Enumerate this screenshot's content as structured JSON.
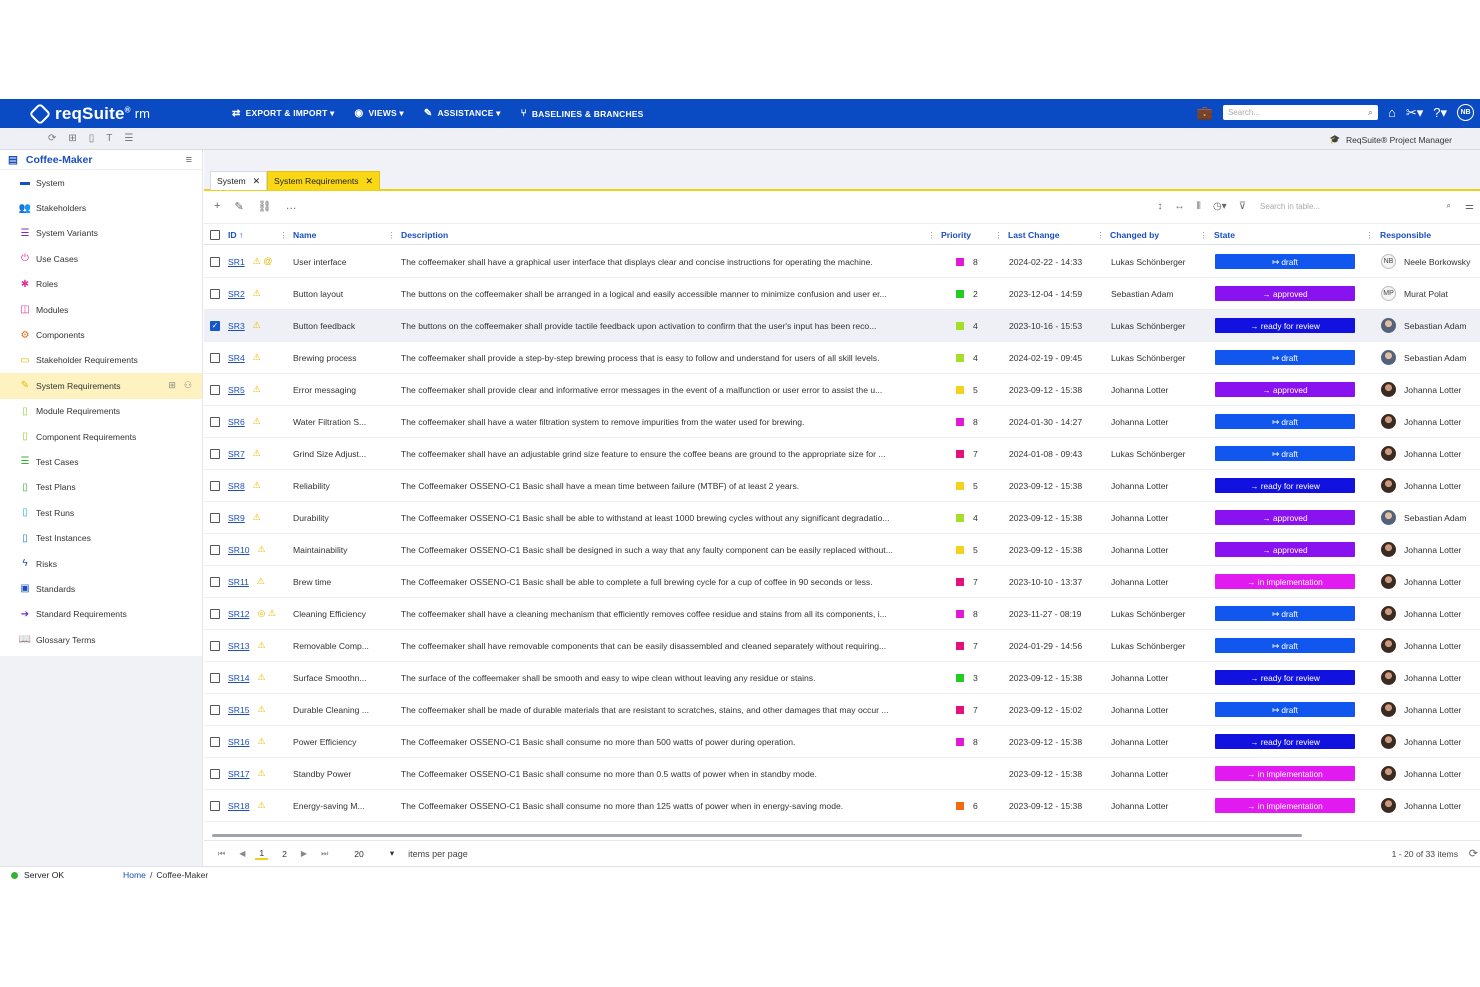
{
  "topbar": {
    "brand": "reqSuite",
    "brand_sup": "®",
    "brand_suffix": "rm",
    "nav": [
      {
        "icon": "⇄",
        "label": "EXPORT & IMPORT ▾"
      },
      {
        "icon": "◉",
        "label": "VIEWS ▾"
      },
      {
        "icon": "✎",
        "label": "ASSISTANCE ▾"
      },
      {
        "icon": "⑂",
        "label": "BASELINES & BRANCHES"
      }
    ],
    "search_placeholder": "Search...",
    "avatar": "NB"
  },
  "subbar": {
    "project_manager": "ReqSuite® Project Manager"
  },
  "sidebar": {
    "title": "Coffee-Maker",
    "items": [
      {
        "label": "System",
        "icon": "▬",
        "color": "#1a4fbf"
      },
      {
        "label": "Stakeholders",
        "icon": "👥",
        "color": "#1a4fbf"
      },
      {
        "label": "System Variants",
        "icon": "☰",
        "color": "#7a2fbf"
      },
      {
        "label": "Use Cases",
        "icon": "⏻",
        "color": "#e0349a"
      },
      {
        "label": "Roles",
        "icon": "✱",
        "color": "#e0349a"
      },
      {
        "label": "Modules",
        "icon": "◫",
        "color": "#e0349a"
      },
      {
        "label": "Components",
        "icon": "⚙",
        "color": "#e06a1a"
      },
      {
        "label": "Stakeholder Requirements",
        "icon": "▭",
        "color": "#e6b800"
      },
      {
        "label": "System Requirements",
        "icon": "✎",
        "color": "#e6b800"
      },
      {
        "label": "Module Requirements",
        "icon": "▯",
        "color": "#9acd32"
      },
      {
        "label": "Component Requirements",
        "icon": "▯",
        "color": "#9acd32"
      },
      {
        "label": "Test Cases",
        "icon": "☰",
        "color": "#34b233"
      },
      {
        "label": "Test Plans",
        "icon": "▯",
        "color": "#34b233"
      },
      {
        "label": "Test Runs",
        "icon": "▯",
        "color": "#1ab0c8"
      },
      {
        "label": "Test Instances",
        "icon": "▯",
        "color": "#1a7fd0"
      },
      {
        "label": "Risks",
        "icon": "ϟ",
        "color": "#1a4fbf"
      },
      {
        "label": "Standards",
        "icon": "▣",
        "color": "#1a4fbf"
      },
      {
        "label": "Standard Requirements",
        "icon": "➔",
        "color": "#7a2fbf"
      },
      {
        "label": "Glossary Terms",
        "icon": "📖",
        "color": "#7a2fbf"
      }
    ]
  },
  "tabs": [
    {
      "label": "System",
      "close": "✕"
    },
    {
      "label": "System Requirements",
      "close": "✕"
    }
  ],
  "table": {
    "search_placeholder": "Search in table...",
    "columns": {
      "id": "ID ↑",
      "name": "Name",
      "description": "Description",
      "priority": "Priority",
      "last_change": "Last Change",
      "changed_by": "Changed by",
      "state": "State",
      "responsible": "Responsible"
    },
    "rows": [
      {
        "id": "SR1",
        "flags": "⚠ @",
        "name": "User interface",
        "desc": "The coffeemaker shall have a graphical user interface that displays clear and concise instructions for operating the machine.",
        "pcolor": "#e21ad6",
        "priority": "8",
        "date": "2024-02-22 - 14:33",
        "by": "Lukas Schönberger",
        "state": "↦ draft",
        "scolor": "#1256f0",
        "resp": "Neele Borkowsky",
        "rinit": "NB"
      },
      {
        "id": "SR2",
        "flags": "⚠",
        "name": "Button layout",
        "desc": "The buttons on the coffeemaker shall be arranged in a logical and easily accessible manner to minimize confusion and user er...",
        "pcolor": "#22cc22",
        "priority": "2",
        "date": "2023-12-04 - 14:59",
        "by": "Sebastian Adam",
        "state": "→ approved",
        "scolor": "#8a12f0",
        "resp": "Murat Polat",
        "rinit": "MP"
      },
      {
        "id": "SR3",
        "flags": "⚠",
        "name": "Button feedback",
        "desc": "The buttons on the coffeemaker shall provide tactile feedback upon activation to confirm that the user's input has been reco...",
        "pcolor": "#a4e02a",
        "priority": "4",
        "date": "2023-10-16 - 15:53",
        "by": "Lukas Schönberger",
        "state": "→ ready for review",
        "scolor": "#1212e0",
        "resp": "Sebastian Adam",
        "rinit": ""
      },
      {
        "id": "SR4",
        "flags": "⚠",
        "name": "Brewing process",
        "desc": "The coffeemaker shall provide a step-by-step brewing process that is easy to follow and understand for users of all skill levels.",
        "pcolor": "#a4e02a",
        "priority": "4",
        "date": "2024-02-19 - 09:45",
        "by": "Lukas Schönberger",
        "state": "↦ draft",
        "scolor": "#1256f0",
        "resp": "Sebastian Adam",
        "rinit": ""
      },
      {
        "id": "SR5",
        "flags": "⚠",
        "name": "Error messaging",
        "desc": "The coffeemaker shall provide clear and informative error messages in the event of a malfunction or user error to assist the u...",
        "pcolor": "#f2d21a",
        "priority": "5",
        "date": "2023-09-12 - 15:38",
        "by": "Johanna Lotter",
        "state": "→ approved",
        "scolor": "#8a12f0",
        "resp": "Johanna Lotter",
        "rinit": ""
      },
      {
        "id": "SR6",
        "flags": "⚠",
        "name": "Water Filtration S...",
        "desc": "The coffeemaker shall have a water filtration system to remove impurities from the water used for brewing.",
        "pcolor": "#e21ad6",
        "priority": "8",
        "date": "2024-01-30 - 14:27",
        "by": "Johanna Lotter",
        "state": "↦ draft",
        "scolor": "#1256f0",
        "resp": "Johanna Lotter",
        "rinit": ""
      },
      {
        "id": "SR7",
        "flags": "⚠",
        "name": "Grind Size Adjust...",
        "desc": "The coffeemaker shall have an adjustable grind size feature to ensure the coffee beans are ground to the appropriate size for ...",
        "pcolor": "#e2127a",
        "priority": "7",
        "date": "2024-01-08 - 09:43",
        "by": "Lukas Schönberger",
        "state": "↦ draft",
        "scolor": "#1256f0",
        "resp": "Johanna Lotter",
        "rinit": ""
      },
      {
        "id": "SR8",
        "flags": "⚠",
        "name": "Reliability",
        "desc": "The Coffeemaker OSSENO-C1 Basic shall have a mean time between failure (MTBF) of at least 2 years.",
        "pcolor": "#f2d21a",
        "priority": "5",
        "date": "2023-09-12 - 15:38",
        "by": "Johanna Lotter",
        "state": "→ ready for review",
        "scolor": "#1212e0",
        "resp": "Johanna Lotter",
        "rinit": ""
      },
      {
        "id": "SR9",
        "flags": "⚠",
        "name": "Durability",
        "desc": "The Coffeemaker OSSENO-C1 Basic shall be able to withstand at least 1000 brewing cycles without any significant degradatio...",
        "pcolor": "#a4e02a",
        "priority": "4",
        "date": "2023-09-12 - 15:38",
        "by": "Johanna Lotter",
        "state": "→ approved",
        "scolor": "#8a12f0",
        "resp": "Sebastian Adam",
        "rinit": ""
      },
      {
        "id": "SR10",
        "flags": "⚠",
        "name": "Maintainability",
        "desc": "The Coffeemaker OSSENO-C1 Basic shall be designed in such a way that any faulty component can be easily replaced without...",
        "pcolor": "#f2d21a",
        "priority": "5",
        "date": "2023-09-12 - 15:38",
        "by": "Johanna Lotter",
        "state": "→ approved",
        "scolor": "#8a12f0",
        "resp": "Johanna Lotter",
        "rinit": ""
      },
      {
        "id": "SR11",
        "flags": "⚠",
        "name": "Brew time",
        "desc": "The Coffeemaker OSSENO-C1 Basic shall be able to complete a full brewing cycle for a cup of coffee in 90 seconds or less.",
        "pcolor": "#e2127a",
        "priority": "7",
        "date": "2023-10-10 - 13:37",
        "by": "Johanna Lotter",
        "state": "→ in implementation",
        "scolor": "#e01af0",
        "resp": "Johanna Lotter",
        "rinit": ""
      },
      {
        "id": "SR12",
        "flags": "◎ ⚠",
        "name": "Cleaning Efficiency",
        "desc": "The coffeemaker shall have a cleaning mechanism that efficiently removes coffee residue and stains from all its components, i...",
        "pcolor": "#e21ad6",
        "priority": "8",
        "date": "2023-11-27 - 08:19",
        "by": "Lukas Schönberger",
        "state": "↦ draft",
        "scolor": "#1256f0",
        "resp": "Johanna Lotter",
        "rinit": ""
      },
      {
        "id": "SR13",
        "flags": "⚠",
        "name": "Removable Comp...",
        "desc": "The coffeemaker shall have removable components that can be easily disassembled and cleaned separately without requiring...",
        "pcolor": "#e2127a",
        "priority": "7",
        "date": "2024-01-29 - 14:56",
        "by": "Lukas Schönberger",
        "state": "↦ draft",
        "scolor": "#1256f0",
        "resp": "Johanna Lotter",
        "rinit": ""
      },
      {
        "id": "SR14",
        "flags": "⚠",
        "name": "Surface Smoothn...",
        "desc": "The surface of the coffeemaker shall be smooth and easy to wipe clean without leaving any residue or stains.",
        "pcolor": "#22cc22",
        "priority": "3",
        "date": "2023-09-12 - 15:38",
        "by": "Johanna Lotter",
        "state": "→ ready for review",
        "scolor": "#1212e0",
        "resp": "Johanna Lotter",
        "rinit": ""
      },
      {
        "id": "SR15",
        "flags": "⚠",
        "name": "Durable Cleaning ...",
        "desc": "The coffeemaker shall be made of durable materials that are resistant to scratches, stains, and other damages that may occur ...",
        "pcolor": "#e2127a",
        "priority": "7",
        "date": "2023-09-12 - 15:02",
        "by": "Johanna Lotter",
        "state": "↦ draft",
        "scolor": "#1256f0",
        "resp": "Johanna Lotter",
        "rinit": ""
      },
      {
        "id": "SR16",
        "flags": "⚠",
        "name": "Power Efficiency",
        "desc": "The Coffeemaker OSSENO-C1 Basic shall consume no more than 500 watts of power during operation.",
        "pcolor": "#e21ad6",
        "priority": "8",
        "date": "2023-09-12 - 15:38",
        "by": "Johanna Lotter",
        "state": "→ ready for review",
        "scolor": "#1212e0",
        "resp": "Johanna Lotter",
        "rinit": ""
      },
      {
        "id": "SR17",
        "flags": "⚠",
        "name": "Standby Power",
        "desc": "The Coffeemaker OSSENO-C1 Basic shall consume no more than 0.5 watts of power when in standby mode.",
        "pcolor": "",
        "priority": "",
        "date": "2023-09-12 - 15:38",
        "by": "Johanna Lotter",
        "state": "→ in implementation",
        "scolor": "#e01af0",
        "resp": "Johanna Lotter",
        "rinit": ""
      },
      {
        "id": "SR18",
        "flags": "⚠",
        "name": "Energy-saving M...",
        "desc": "The Coffeemaker OSSENO-C1 Basic shall consume no more than 125 watts of power when in energy-saving mode.",
        "pcolor": "#f26a12",
        "priority": "6",
        "date": "2023-09-12 - 15:38",
        "by": "Johanna Lotter",
        "state": "→ in implementation",
        "scolor": "#e01af0",
        "resp": "Johanna Lotter",
        "rinit": ""
      }
    ]
  },
  "pager": {
    "pages": [
      "1",
      "2"
    ],
    "page_size": "20",
    "page_size_caret": "▾",
    "items_per_page": "items per page",
    "info": "1 - 20 of 33 items"
  },
  "statusbar": {
    "server": "Server OK",
    "crumb_home": "Home",
    "crumb_sep": "/",
    "crumb_current": "Coffee-Maker"
  }
}
